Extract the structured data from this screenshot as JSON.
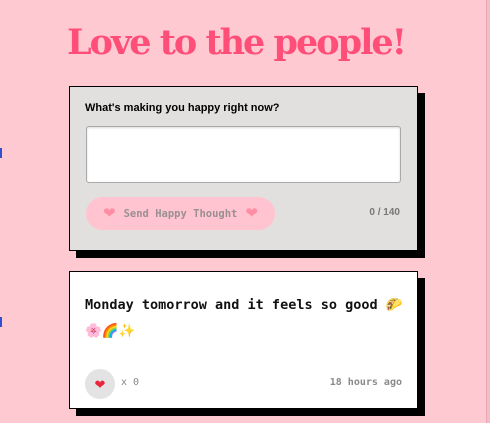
{
  "page": {
    "title": "Love to the people!"
  },
  "form": {
    "prompt": "What's making you happy right now?",
    "input_value": "",
    "input_placeholder": "",
    "send_label": "Send Happy Thought",
    "heart_glyph": "❤",
    "char_count": "0 / 140"
  },
  "thought": {
    "message": "Monday tomorrow and it feels so good 🌮🌸🌈✨",
    "heart_glyph": "❤",
    "likes_label": "x 0",
    "time_ago": "18 hours ago"
  },
  "colors": {
    "background": "#ffc9d2",
    "title": "#ff4f79",
    "form_card": "#e2e0de",
    "send_button": "#ffc4cf",
    "like_button": "#e3e3e3"
  }
}
